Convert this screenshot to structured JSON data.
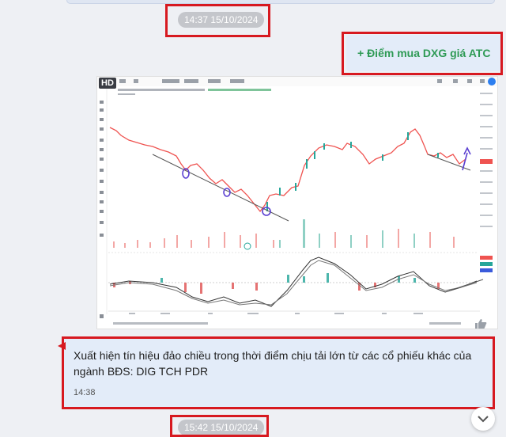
{
  "messages": {
    "time_chip_1": "14:37 15/10/2024",
    "buy_note": "+ Điểm mua DXG giá ATC",
    "reply_text": "Xuất hiện tín hiệu đảo chiều trong thời điểm chịu tải lớn từ các cổ phiếu khác của ngành BĐS: DIG TCH PDR",
    "reply_time": "14:38",
    "time_chip_2": "15:42 15/10/2024"
  },
  "image": {
    "hd_badge": "HD"
  },
  "chart_data": {
    "type": "line",
    "annotations": [
      "HD"
    ],
    "up_arrow": true,
    "down_trendline": true
  },
  "colors": {
    "highlight_red": "#d71920",
    "buy_green": "#2e9a55",
    "bubble_blue": "#e3ecf9",
    "candle_up": "#26a69a",
    "candle_down": "#ef5350",
    "marker_purple": "#5a3fd1"
  },
  "icons": {
    "thumb": "like-icon",
    "more": "more-options-icon",
    "scroll": "chevron-down-icon"
  }
}
